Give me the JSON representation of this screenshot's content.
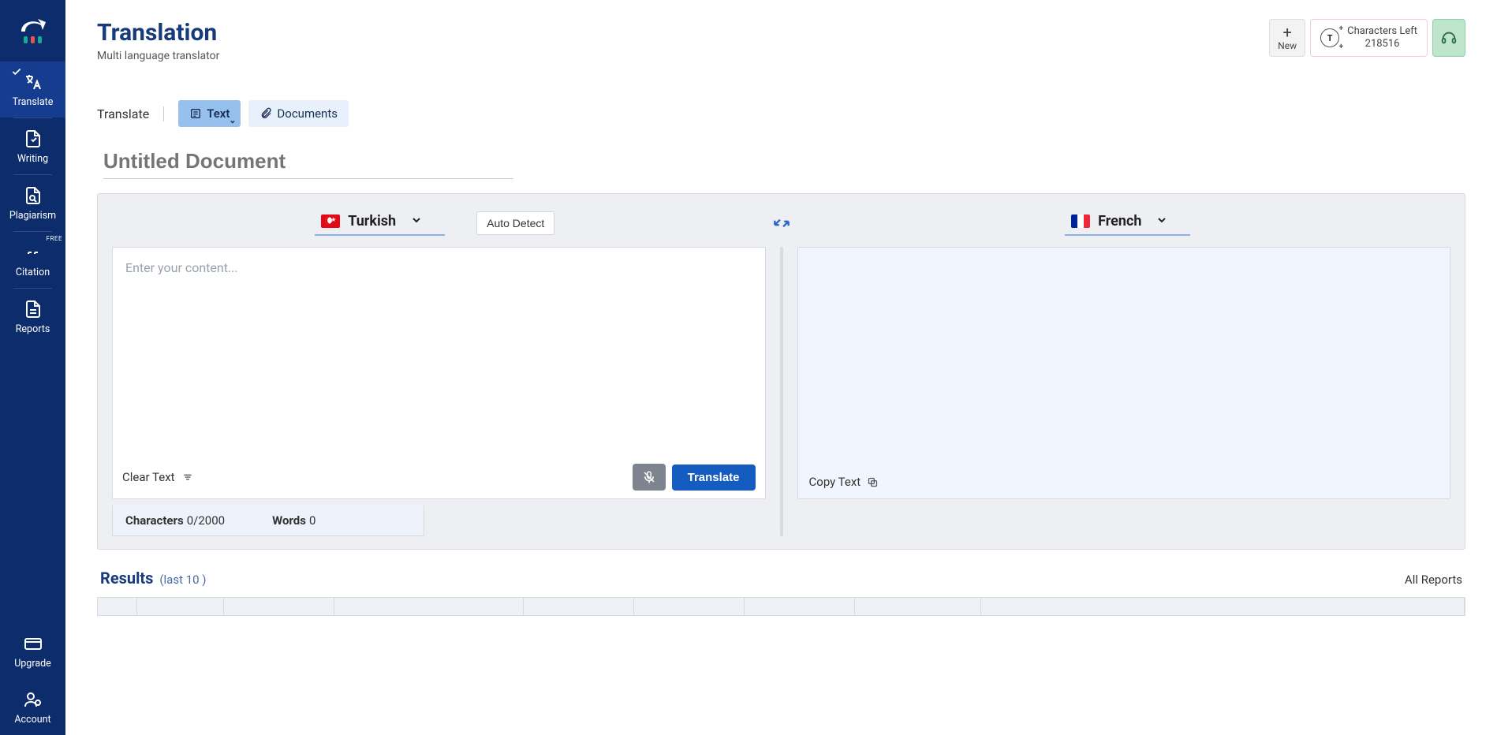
{
  "sidebar": {
    "items": [
      {
        "label": "Translate"
      },
      {
        "label": "Writing"
      },
      {
        "label": "Plagiarism"
      },
      {
        "label": "Citation",
        "badge": "FREE"
      },
      {
        "label": "Reports"
      }
    ],
    "bottom": [
      {
        "label": "Upgrade"
      },
      {
        "label": "Account"
      }
    ]
  },
  "header": {
    "title": "Translation",
    "subtitle": "Multi language translator",
    "new_label": "New",
    "chars_label": "Characters Left",
    "chars_value": "218516"
  },
  "tabs": {
    "section_label": "Translate",
    "text_label": "Text",
    "documents_label": "Documents"
  },
  "doc": {
    "title_placeholder": "Untitled Document"
  },
  "lang": {
    "source": "Turkish",
    "target": "French",
    "auto_detect": "Auto Detect"
  },
  "editor": {
    "placeholder": "Enter your content...",
    "clear_label": "Clear Text",
    "translate_label": "Translate",
    "copy_label": "Copy Text",
    "chars_label": "Characters",
    "chars_value": "0/2000",
    "words_label": "Words",
    "words_value": "0"
  },
  "results": {
    "title": "Results",
    "sub": "(last 10 )",
    "all_reports": "All Reports"
  }
}
